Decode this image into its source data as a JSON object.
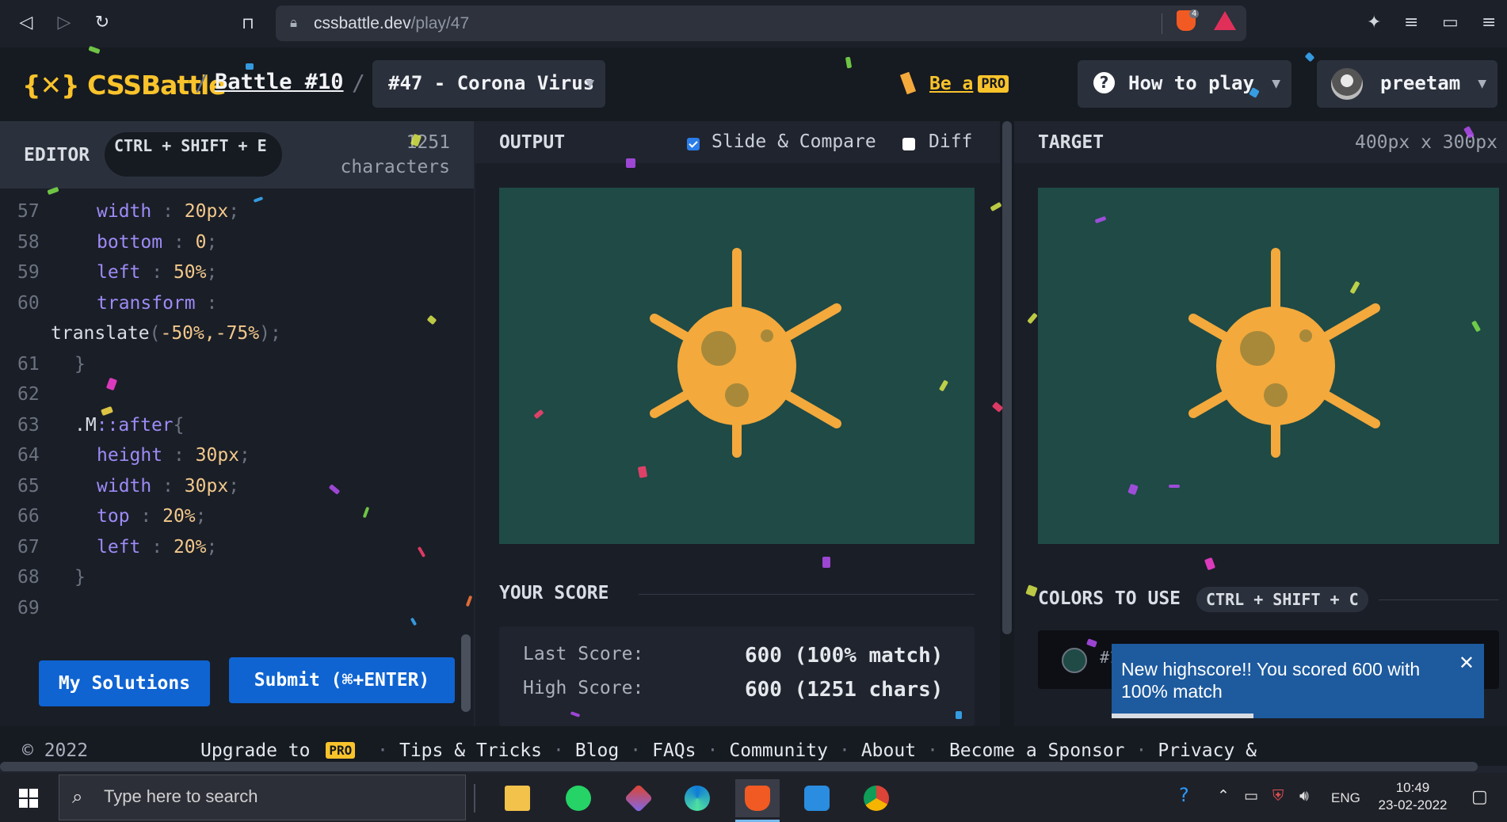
{
  "browser": {
    "url_host": "cssbattle.dev",
    "url_path": "/play/47",
    "brave_shield_count": "4"
  },
  "header": {
    "logo": "{✕} CSSBattle",
    "separator": "/",
    "battle_link": "Battle #10",
    "challenge": "#47 - Corona Virus",
    "be_a": "Be a",
    "pro": "PRO",
    "how_to_play": "How to play",
    "user_name": "preetam"
  },
  "editor": {
    "title": "EDITOR",
    "shortcut": "CTRL + SHIFT + E",
    "char_count": "1251 characters",
    "my_solutions": "My Solutions",
    "submit": "Submit (⌘+ENTER)",
    "lines": [
      {
        "n": "57",
        "prop": "width",
        "val": "20px"
      },
      {
        "n": "58",
        "prop": "bottom",
        "val": "0"
      },
      {
        "n": "59",
        "prop": "left",
        "val": "50%"
      },
      {
        "n": "60",
        "prop": "transform",
        "val": ""
      },
      {
        "n": "",
        "fn": "translate",
        "args": "-50%,-75%"
      },
      {
        "n": "61",
        "text": "}"
      },
      {
        "n": "62",
        "text": ""
      },
      {
        "n": "63",
        "sel": ".M",
        "pseudo": "::after",
        "brace": "{"
      },
      {
        "n": "64",
        "prop": "height",
        "val": "30px"
      },
      {
        "n": "65",
        "prop": "width",
        "val": "30px"
      },
      {
        "n": "66",
        "prop": "top",
        "val": "20%"
      },
      {
        "n": "67",
        "prop": "left",
        "val": "20%"
      },
      {
        "n": "68",
        "text": "}"
      },
      {
        "n": "69",
        "text": ""
      }
    ]
  },
  "output": {
    "title": "OUTPUT",
    "slide_compare": "Slide & Compare",
    "slide_compare_checked": true,
    "diff": "Diff",
    "diff_checked": false,
    "your_score": "YOUR SCORE",
    "last_score_label": "Last Score:",
    "last_score_value": "600 (100% match)",
    "high_score_label": "High Score:",
    "high_score_value": "600 (1251 chars)"
  },
  "target": {
    "title": "TARGET",
    "dims": "400px x 300px",
    "colors_to_use": "COLORS TO USE",
    "colors_shortcut": "CTRL + SHIFT + C",
    "swatch_label": "#1"
  },
  "toast": {
    "message": "New highscore!! You scored 600 with 100% match",
    "close": "✕",
    "progress": 0.38
  },
  "colors": {
    "canvas_bg": "#1f4a46",
    "virus": "#f3a93c",
    "virus_spot": "#a8893a",
    "accent": "#f9c32b",
    "button_blue": "#0f64d2"
  },
  "footer": {
    "copyright": "© 2022",
    "upgrade_to": "Upgrade to",
    "pro": "PRO",
    "links": [
      "Tips & Tricks",
      "Blog",
      "FAQs",
      "Community",
      "About",
      "Become a Sponsor",
      "Privacy &"
    ]
  },
  "taskbar": {
    "search_placeholder": "Type here to search",
    "apps": [
      "file-explorer",
      "whatsapp",
      "git",
      "edge",
      "brave",
      "vscode",
      "chrome"
    ],
    "lang": "ENG",
    "time": "10:49",
    "date": "23-02-2022"
  }
}
